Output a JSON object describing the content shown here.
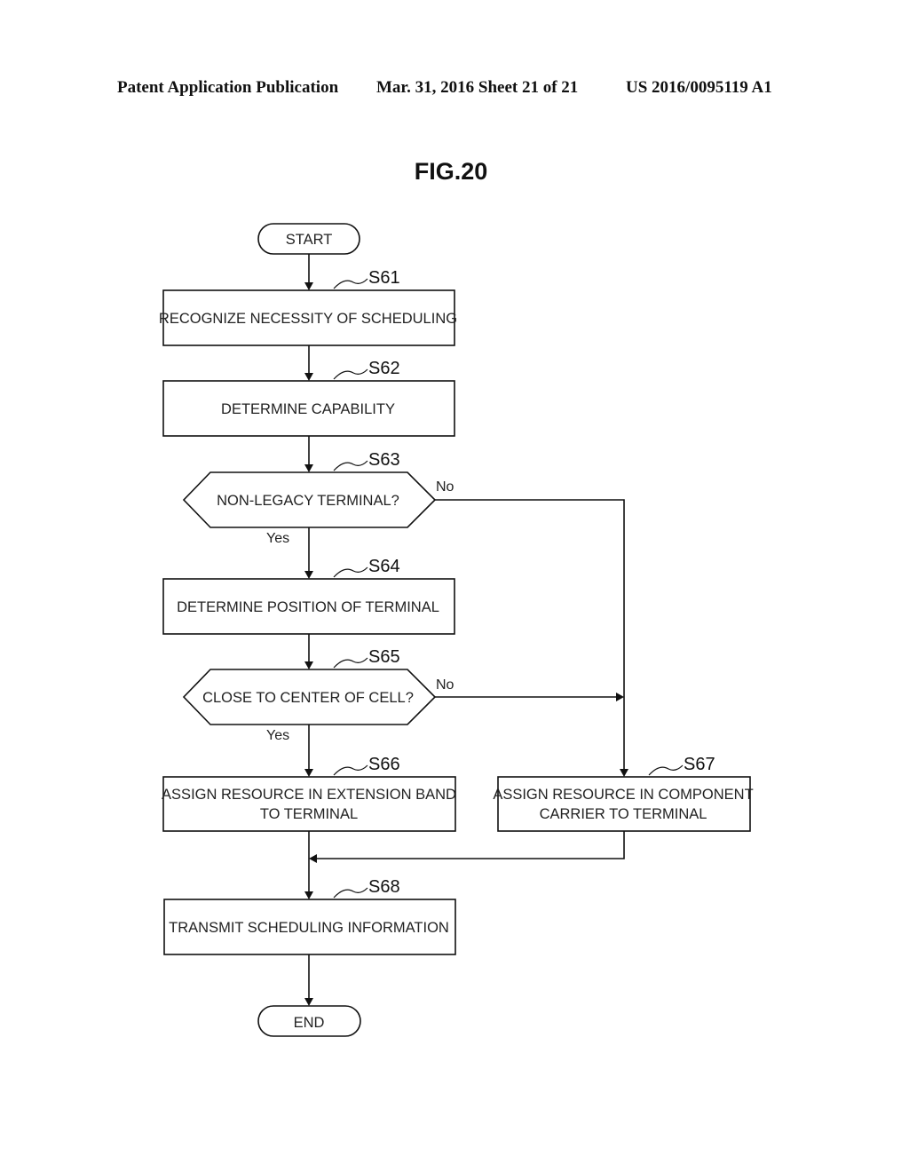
{
  "header": {
    "publication": "Patent Application Publication",
    "date_sheet": "Mar. 31, 2016  Sheet 21 of 21",
    "number": "US 2016/0095119 A1"
  },
  "figure": {
    "title": "FIG.20",
    "terminals": {
      "start": "START",
      "end": "END"
    },
    "steps": {
      "s61": {
        "id": "S61",
        "text": "RECOGNIZE NECESSITY OF SCHEDULING"
      },
      "s62": {
        "id": "S62",
        "text": "DETERMINE CAPABILITY"
      },
      "s63": {
        "id": "S63",
        "text": "NON-LEGACY TERMINAL?"
      },
      "s64": {
        "id": "S64",
        "text": "DETERMINE POSITION OF TERMINAL"
      },
      "s65": {
        "id": "S65",
        "text": "CLOSE TO CENTER OF CELL?"
      },
      "s66": {
        "id": "S66",
        "line1": "ASSIGN RESOURCE IN EXTENSION BAND",
        "line2": "TO TERMINAL"
      },
      "s67": {
        "id": "S67",
        "line1": "ASSIGN RESOURCE IN COMPONENT",
        "line2": "CARRIER TO TERMINAL"
      },
      "s68": {
        "id": "S68",
        "text": "TRANSMIT SCHEDULING INFORMATION"
      }
    },
    "branches": {
      "s63_yes": "Yes",
      "s63_no": "No",
      "s65_yes": "Yes",
      "s65_no": "No"
    }
  }
}
